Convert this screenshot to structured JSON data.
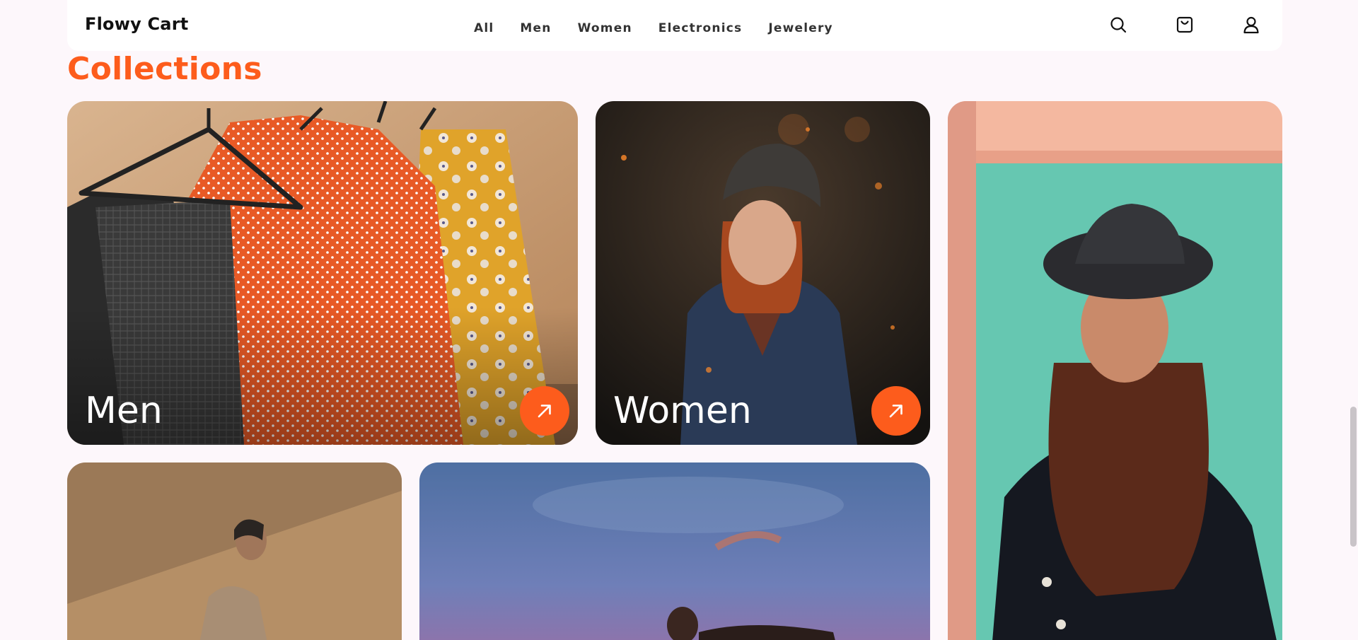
{
  "header": {
    "logo": "Flowy Cart",
    "nav": [
      "All",
      "Men",
      "Women",
      "Electronics",
      "Jewelery"
    ],
    "icons": [
      "search-icon",
      "cart-icon",
      "user-icon"
    ]
  },
  "collections": {
    "title": "Collections",
    "cards": [
      {
        "label": "Men",
        "icon": "arrow-up-right-icon"
      },
      {
        "label": "Women",
        "icon": "arrow-up-right-icon"
      },
      {
        "label": ""
      },
      {
        "label": ""
      },
      {
        "label": ""
      }
    ]
  },
  "colors": {
    "accent": "#fd5c1c",
    "background": "#fdf7fb",
    "header_bg": "#ffffff",
    "text": "#111111"
  }
}
